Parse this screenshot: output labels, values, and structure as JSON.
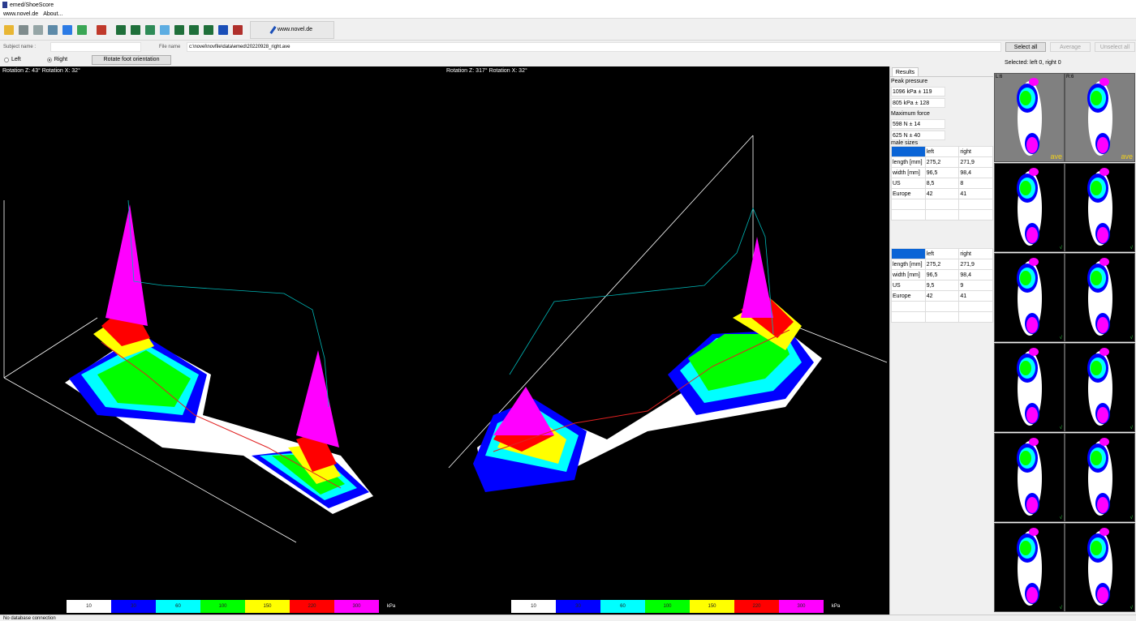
{
  "window": {
    "title": "emed/ShoeScore"
  },
  "menu": {
    "items": [
      "www.novel.de",
      "About..."
    ]
  },
  "toolbar": {
    "link_label": "www.novel.de"
  },
  "subject": {
    "label": "Subject name :",
    "value": ""
  },
  "file": {
    "label": "File name",
    "value": "c:\\novel\\novfile\\data\\emed\\20220928_right.ave"
  },
  "side": {
    "left_label": "Left",
    "right_label": "Right",
    "selected": "Right"
  },
  "rotate_button": "Rotate foot orientation",
  "selection": {
    "select_all": "Select all",
    "average": "Average",
    "unselect_all": "Unselect all",
    "status": "Selected: left 0, right 0"
  },
  "views": {
    "left": {
      "rotation": "Rotation Z: 43° Rotation X: 32°"
    },
    "right": {
      "rotation": "Rotation Z: 317° Rotation X: 32°"
    }
  },
  "legend": {
    "values": [
      "10",
      "30",
      "60",
      "100",
      "150",
      "220",
      "300"
    ],
    "colors": [
      "#ffffff",
      "#0000ff",
      "#00ffff",
      "#00ff00",
      "#ffff00",
      "#ff0000",
      "#ff00ff"
    ],
    "unit": "kPa"
  },
  "results": {
    "tab": "Results",
    "peak_label": "Peak pressure",
    "peak_left": "1096 kPa ± 119",
    "peak_right": "805 kPa ± 128",
    "force_label": "Maximum force",
    "force_left": "598 N ± 14",
    "force_right": "625 N ± 40",
    "sizes_label": "male sizes",
    "table1": {
      "header": [
        "",
        "left",
        "right"
      ],
      "rows": [
        [
          "length [mm]",
          "275,2",
          "271,9"
        ],
        [
          "width [mm]",
          "96,5",
          "98,4"
        ],
        [
          "US",
          "8,5",
          "8"
        ],
        [
          "Europe",
          "42",
          "41"
        ]
      ]
    },
    "table2": {
      "header": [
        "",
        "left",
        "right"
      ],
      "rows": [
        [
          "length [mm]",
          "275,2",
          "271,9"
        ],
        [
          "width [mm]",
          "96,5",
          "98,4"
        ],
        [
          "US",
          "9,5",
          "9"
        ],
        [
          "Europe",
          "42",
          "41"
        ]
      ]
    }
  },
  "thumbnails": {
    "top_left": "L:6",
    "top_right": "R:6",
    "ave": "ave",
    "check": "√"
  },
  "status": "No database connection"
}
